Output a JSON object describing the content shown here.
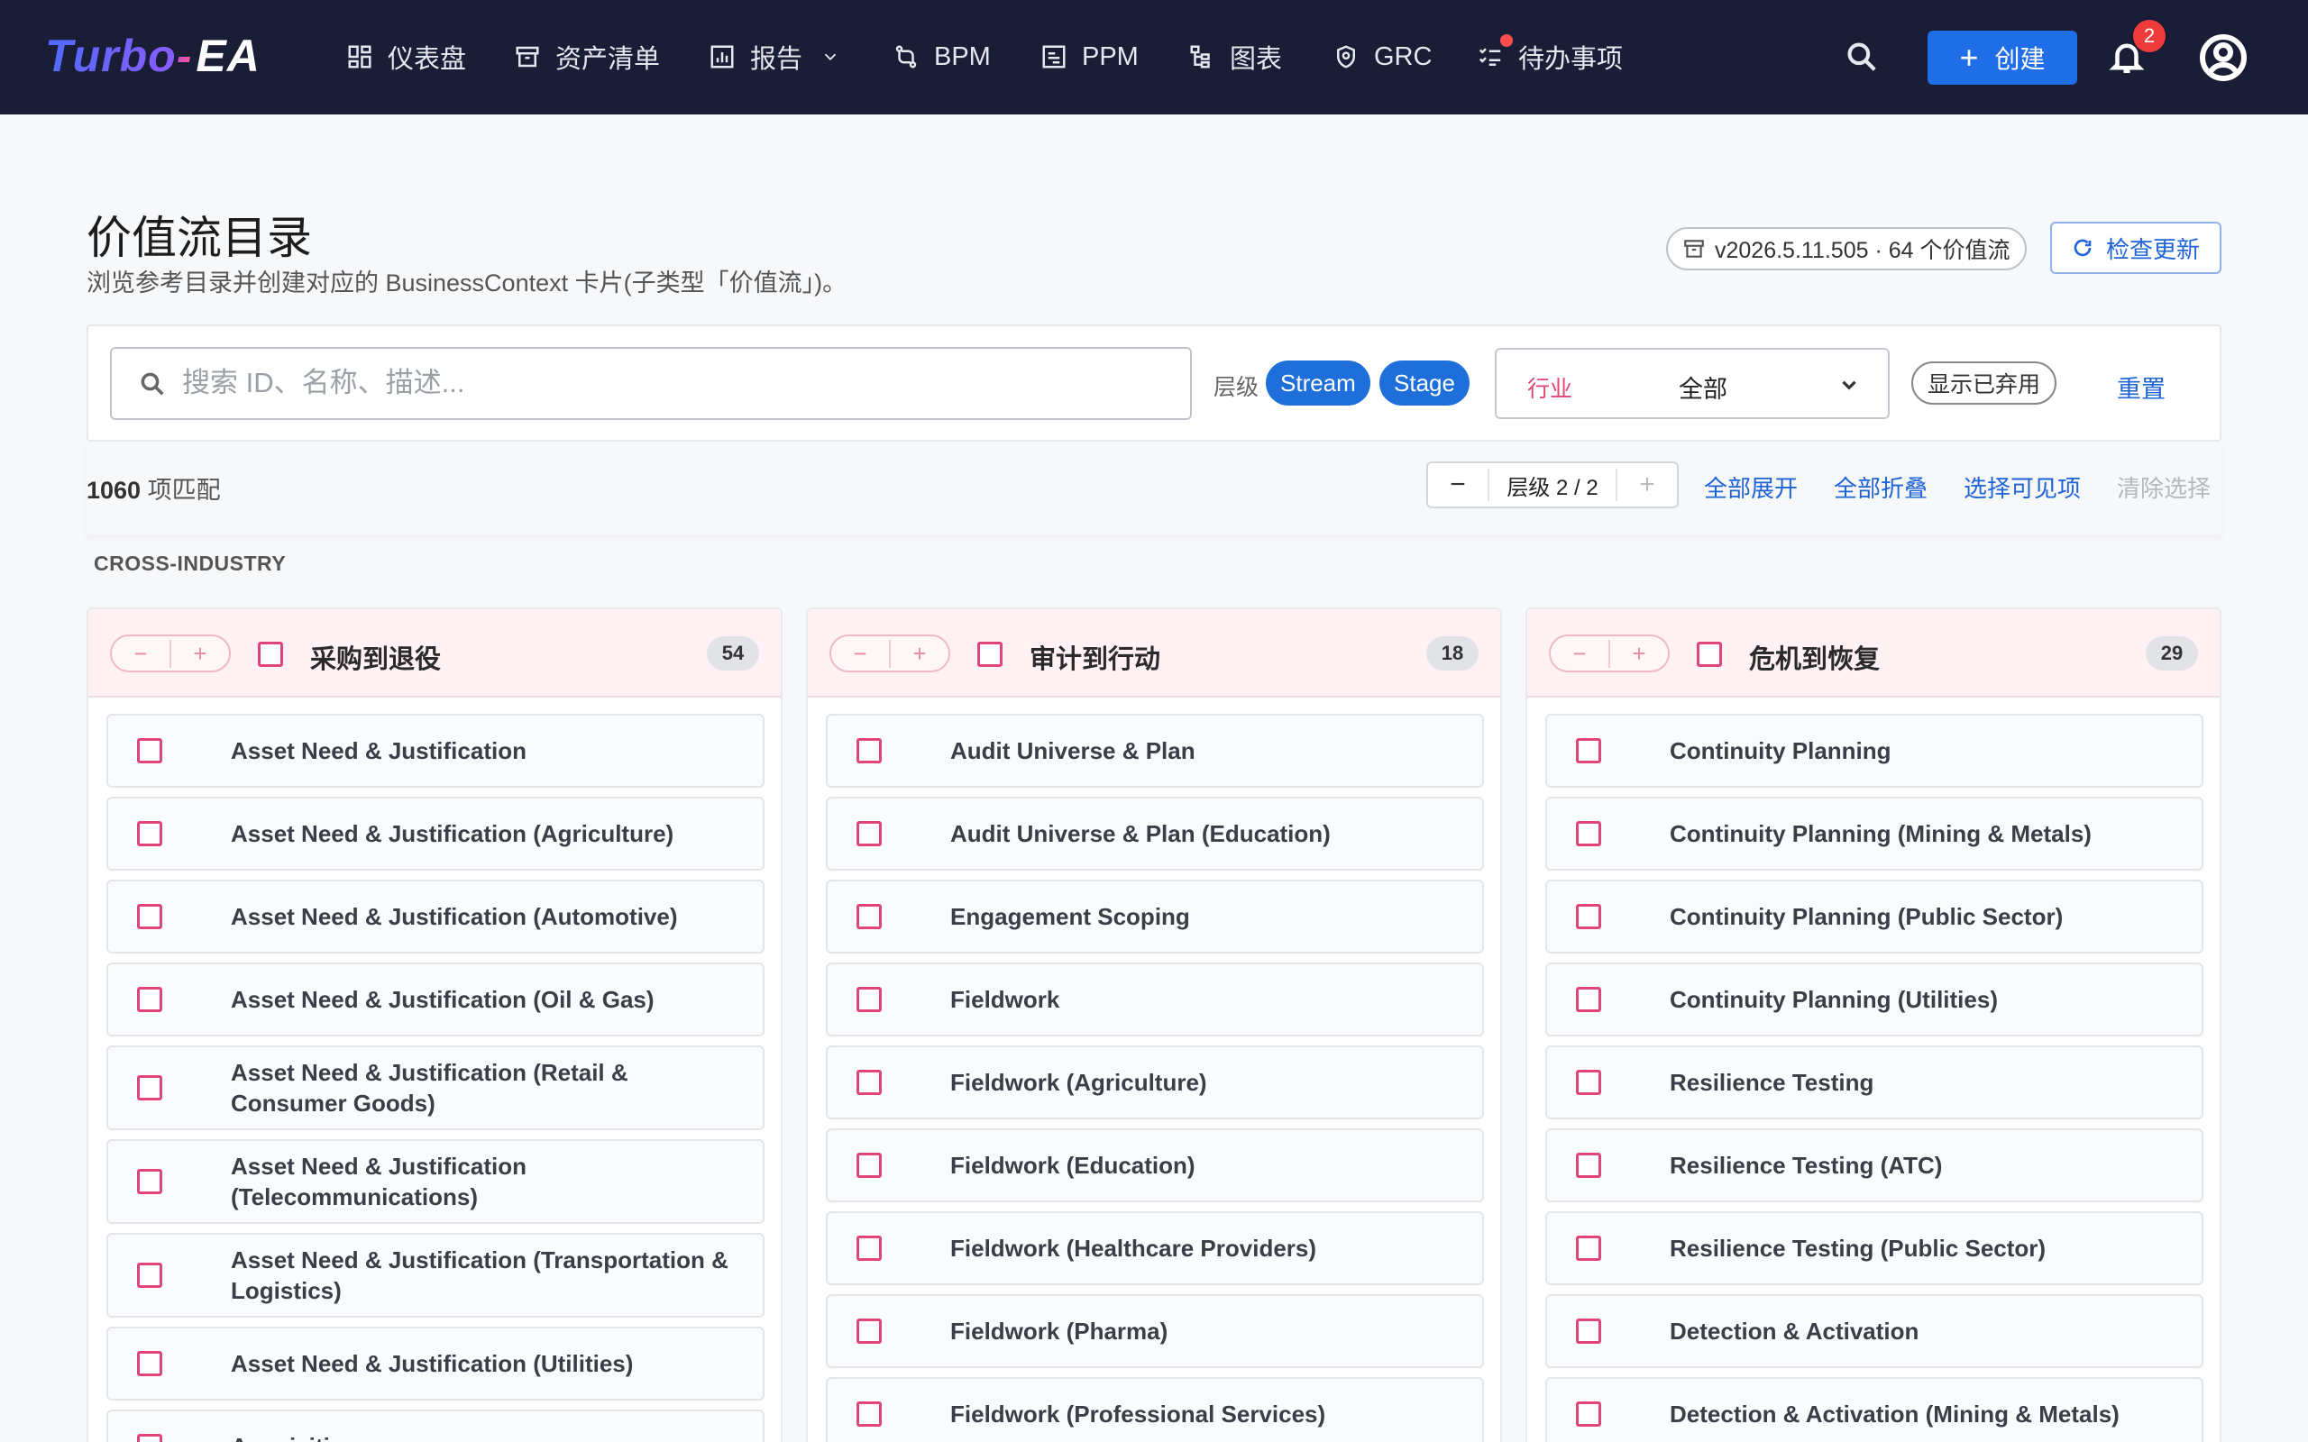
{
  "nav": {
    "logo_parts": [
      "Turbo",
      "-",
      "EA"
    ],
    "items": [
      {
        "label": "仪表盘",
        "icon": "dashboard-icon"
      },
      {
        "label": "资产清单",
        "icon": "inventory-icon"
      },
      {
        "label": "报告",
        "icon": "report-icon"
      },
      {
        "label": "BPM",
        "icon": "bpm-icon"
      },
      {
        "label": "PPM",
        "icon": "ppm-icon"
      },
      {
        "label": "图表",
        "icon": "diagram-icon"
      },
      {
        "label": "GRC",
        "icon": "shield-icon"
      },
      {
        "label": "待办事项",
        "icon": "todo-icon"
      }
    ],
    "create_label": "创建",
    "notification_count": "2"
  },
  "header": {
    "title": "价值流目录",
    "subtitle": "浏览参考目录并创建对应的 BusinessContext 卡片(子类型「价值流」)。",
    "version": "v2026.5.11.505 · 64 个价值流",
    "check_update": "检查更新"
  },
  "filters": {
    "search_placeholder": "搜索 ID、名称、描述...",
    "level_label": "层级",
    "level_chips": [
      "Stream",
      "Stage"
    ],
    "industry_label": "行业",
    "industry_value": "全部",
    "show_deprecated": "显示已弃用",
    "reset": "重置"
  },
  "toolbar": {
    "match_number": "1060",
    "match_suffix": " 项匹配",
    "level_display": "层级 2 / 2",
    "expand_all": "全部展开",
    "collapse_all": "全部折叠",
    "select_visible": "选择可见项",
    "clear_selection": "清除选择"
  },
  "section_label": "CROSS-INDUSTRY",
  "columns": [
    {
      "title": "采购到退役",
      "count": "54",
      "items": [
        "Asset Need & Justification",
        "Asset Need & Justification (Agriculture)",
        "Asset Need & Justification (Automotive)",
        "Asset Need & Justification (Oil & Gas)",
        "Asset Need & Justification (Retail & Consumer Goods)",
        "Asset Need & Justification (Telecommunications)",
        "Asset Need & Justification (Transportation & Logistics)",
        "Asset Need & Justification (Utilities)",
        "Acquisition"
      ]
    },
    {
      "title": "审计到行动",
      "count": "18",
      "items": [
        "Audit Universe & Plan",
        "Audit Universe & Plan (Education)",
        "Engagement Scoping",
        "Fieldwork",
        "Fieldwork (Agriculture)",
        "Fieldwork (Education)",
        "Fieldwork (Healthcare Providers)",
        "Fieldwork (Pharma)",
        "Fieldwork (Professional Services)"
      ]
    },
    {
      "title": "危机到恢复",
      "count": "29",
      "items": [
        "Continuity Planning",
        "Continuity Planning (Mining & Metals)",
        "Continuity Planning (Public Sector)",
        "Continuity Planning (Utilities)",
        "Resilience Testing",
        "Resilience Testing (ATC)",
        "Resilience Testing (Public Sector)",
        "Detection & Activation",
        "Detection & Activation (Mining & Metals)"
      ]
    }
  ],
  "colors": {
    "nav_bg": "#191d35",
    "primary": "#1f6ee8",
    "accent_pink": "#e0457a",
    "badge_red": "#ef3b3b"
  }
}
